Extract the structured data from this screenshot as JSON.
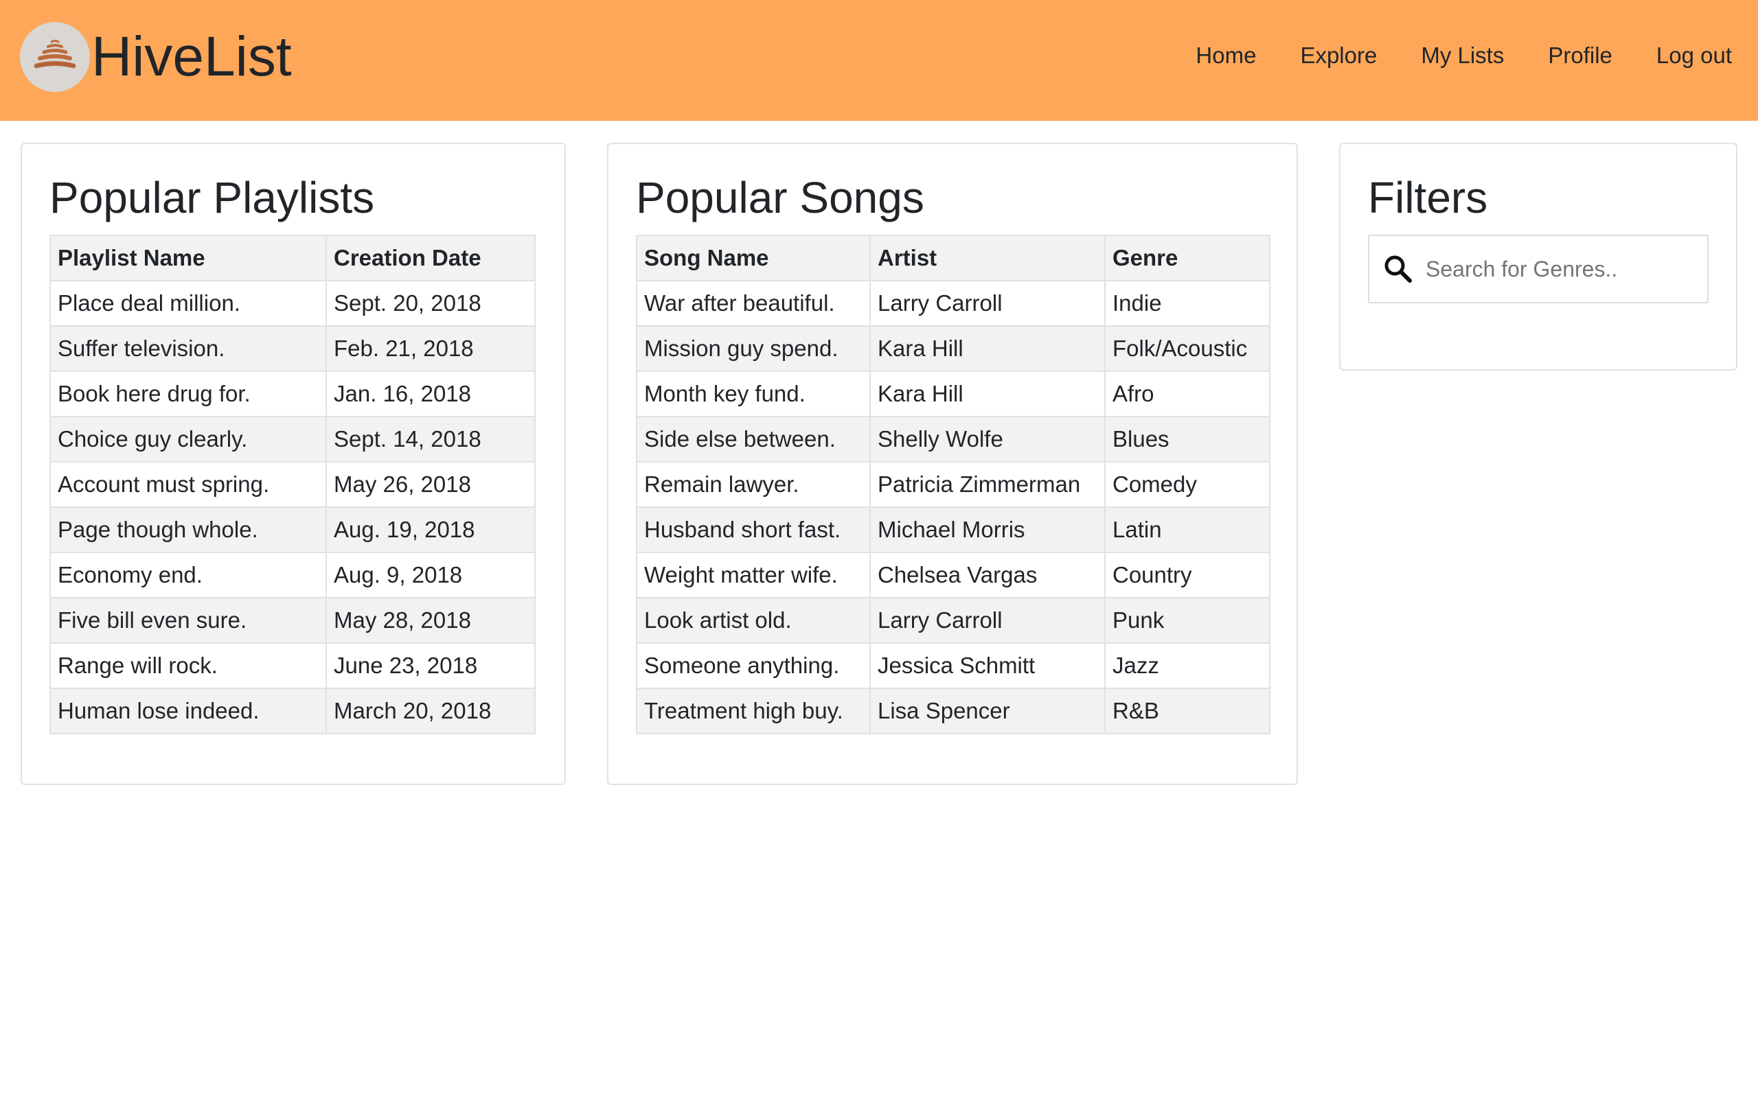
{
  "header": {
    "brand": "HiveList",
    "logo_icon": "hive-logo-icon",
    "nav": [
      "Home",
      "Explore",
      "My Lists",
      "Profile",
      "Log out"
    ],
    "background_color": "#fea758"
  },
  "playlists": {
    "title": "Popular Playlists",
    "columns": [
      "Playlist Name",
      "Creation Date"
    ],
    "rows": [
      [
        "Place deal million.",
        "Sept. 20, 2018"
      ],
      [
        "Suffer television.",
        "Feb. 21, 2018"
      ],
      [
        "Book here drug for.",
        "Jan. 16, 2018"
      ],
      [
        "Choice guy clearly.",
        "Sept. 14, 2018"
      ],
      [
        "Account must spring.",
        "May 26, 2018"
      ],
      [
        "Page though whole.",
        "Aug. 19, 2018"
      ],
      [
        "Economy end.",
        "Aug. 9, 2018"
      ],
      [
        "Five bill even sure.",
        "May 28, 2018"
      ],
      [
        "Range will rock.",
        "June 23, 2018"
      ],
      [
        "Human lose indeed.",
        "March 20, 2018"
      ]
    ]
  },
  "songs": {
    "title": "Popular Songs",
    "columns": [
      "Song Name",
      "Artist",
      "Genre"
    ],
    "rows": [
      [
        "War after beautiful.",
        "Larry Carroll",
        "Indie"
      ],
      [
        "Mission guy spend.",
        "Kara Hill",
        "Folk/Acoustic"
      ],
      [
        "Month key fund.",
        "Kara Hill",
        "Afro"
      ],
      [
        "Side else between.",
        "Shelly Wolfe",
        "Blues"
      ],
      [
        "Remain lawyer.",
        "Patricia Zimmerman",
        "Comedy"
      ],
      [
        "Husband short fast.",
        "Michael Morris",
        "Latin"
      ],
      [
        "Weight matter wife.",
        "Chelsea Vargas",
        "Country"
      ],
      [
        "Look artist old.",
        "Larry Carroll",
        "Punk"
      ],
      [
        "Someone anything.",
        "Jessica Schmitt",
        "Jazz"
      ],
      [
        "Treatment high buy.",
        "Lisa Spencer",
        "R&B"
      ]
    ]
  },
  "filters": {
    "title": "Filters",
    "search_icon": "search-icon",
    "search_placeholder": "Search for Genres..",
    "search_value": ""
  }
}
